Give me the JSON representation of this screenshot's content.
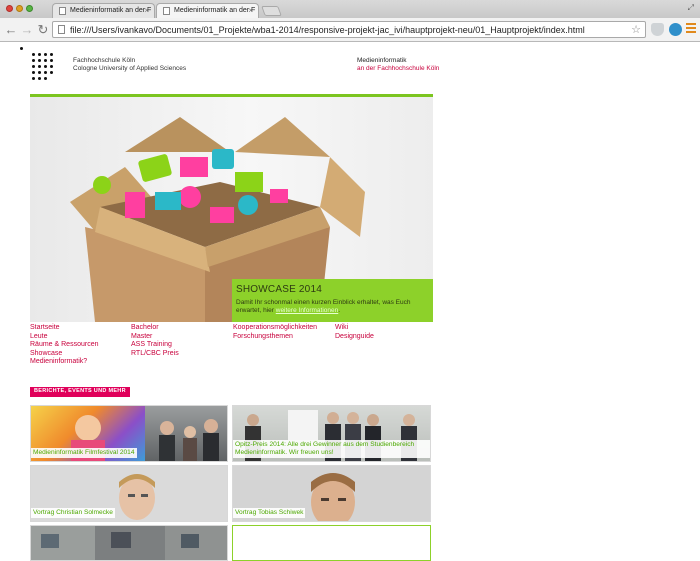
{
  "browser": {
    "tabs": [
      {
        "title": "Medieninformatik an der F",
        "active": false
      },
      {
        "title": "Medieninformatik an der F",
        "active": true
      }
    ],
    "url": "file:///Users/ivankavo/Documents/01_Projekte/wba1-2014/responsive-projekt-jac_ivi/hauptprojekt-neu/01_Hauptprojekt/index.html",
    "icons": {
      "back": "back-arrow-icon",
      "forward": "forward-arrow-icon",
      "reload": "reload-icon",
      "bookmark": "star-icon",
      "menu": "hamburger-menu-icon"
    }
  },
  "header": {
    "university_line1": "Fachhochschule Köln",
    "university_line2": "Cologne University of Applied Sciences",
    "faculty_title": "Medieninformatik",
    "faculty_subtitle": "an der Fachhochschule Köln"
  },
  "hero": {
    "showcase_title": "SHOWCASE 2014",
    "showcase_text": "Damit Ihr schonmal einen kurzen Einblick erhaltet, was Euch erwartet, hier",
    "showcase_link": "weitere Informationen",
    "showcase_suffix": "."
  },
  "nav": {
    "col1": [
      "Startseite",
      "Leute",
      "Räume & Ressourcen",
      "Showcase",
      "Medieninformatik?"
    ],
    "col2": [
      "Bachelor",
      "Master",
      "ASS Training",
      "RTL/CBC Preis"
    ],
    "col3": [
      "Kooperationsmöglichkeiten",
      "Forschungsthemen"
    ],
    "col4": [
      "Wiki",
      "Designguide"
    ]
  },
  "news": {
    "section_label": "BERICHTE, EVENTS UND MEHR",
    "items": [
      {
        "caption": "Medieninformatik Filmfestival 2014"
      },
      {
        "caption": "Opitz-Preis 2014: Alle drei Gewinner aus dem Studienbereich Medieninformatik. Wir freuen uns!"
      },
      {
        "caption": "Vortrag Christian Solmecke"
      },
      {
        "caption": "Vortrag Tobias Schiwek"
      }
    ]
  },
  "colors": {
    "accent_green": "#7cc520",
    "brand_red": "#c8003c",
    "label_pink": "#e0005a"
  }
}
